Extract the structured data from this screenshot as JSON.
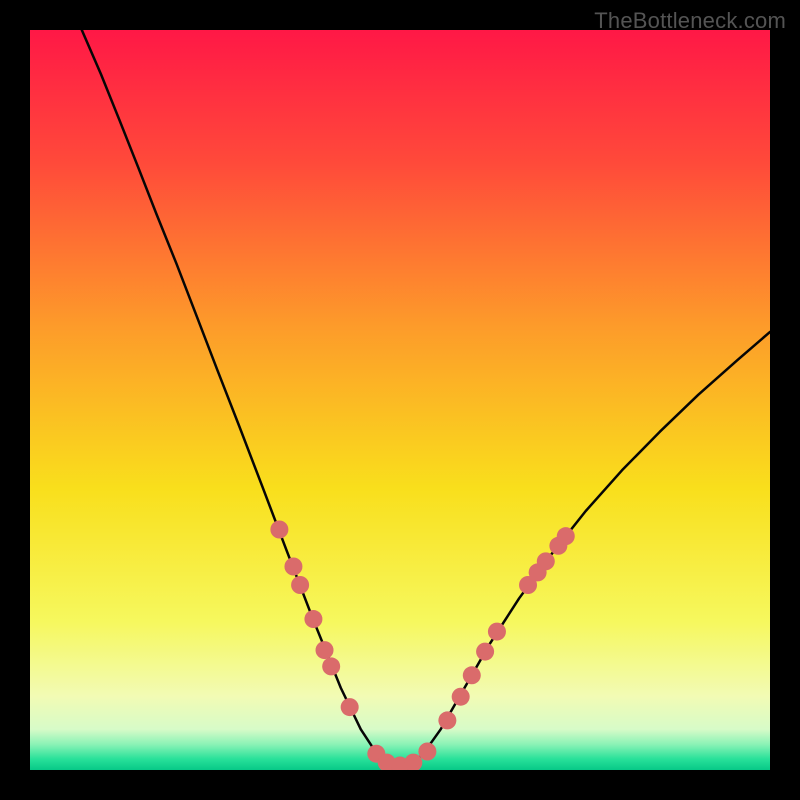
{
  "watermark": "TheBottleneck.com",
  "chart_data": {
    "type": "line",
    "title": "",
    "xlabel": "",
    "ylabel": "",
    "xlim": [
      0,
      1
    ],
    "ylim": [
      0,
      1
    ],
    "background": {
      "type": "vertical_gradient",
      "stops": [
        {
          "pos": 0.0,
          "color": "#ff1846"
        },
        {
          "pos": 0.18,
          "color": "#ff4a3a"
        },
        {
          "pos": 0.4,
          "color": "#fd9b2a"
        },
        {
          "pos": 0.62,
          "color": "#f9df1c"
        },
        {
          "pos": 0.8,
          "color": "#f6f85e"
        },
        {
          "pos": 0.9,
          "color": "#f2fbb4"
        },
        {
          "pos": 0.945,
          "color": "#d7fbc8"
        },
        {
          "pos": 0.965,
          "color": "#8cf3b6"
        },
        {
          "pos": 0.985,
          "color": "#29e19a"
        },
        {
          "pos": 1.0,
          "color": "#07c987"
        }
      ]
    },
    "series": [
      {
        "name": "left_branch",
        "stroke": "#060606",
        "width": 2.5,
        "points": [
          {
            "x": 0.07,
            "y": 1.0
          },
          {
            "x": 0.096,
            "y": 0.94
          },
          {
            "x": 0.121,
            "y": 0.878
          },
          {
            "x": 0.146,
            "y": 0.815
          },
          {
            "x": 0.171,
            "y": 0.751
          },
          {
            "x": 0.198,
            "y": 0.684
          },
          {
            "x": 0.225,
            "y": 0.614
          },
          {
            "x": 0.253,
            "y": 0.541
          },
          {
            "x": 0.283,
            "y": 0.464
          },
          {
            "x": 0.314,
            "y": 0.383
          },
          {
            "x": 0.347,
            "y": 0.296
          },
          {
            "x": 0.382,
            "y": 0.205
          },
          {
            "x": 0.42,
            "y": 0.111
          },
          {
            "x": 0.447,
            "y": 0.055
          },
          {
            "x": 0.47,
            "y": 0.02
          },
          {
            "x": 0.49,
            "y": 0.005
          },
          {
            "x": 0.51,
            "y": 0.005
          }
        ]
      },
      {
        "name": "right_branch",
        "stroke": "#060606",
        "width": 2.5,
        "points": [
          {
            "x": 0.49,
            "y": 0.005
          },
          {
            "x": 0.51,
            "y": 0.005
          },
          {
            "x": 0.53,
            "y": 0.02
          },
          {
            "x": 0.555,
            "y": 0.055
          },
          {
            "x": 0.586,
            "y": 0.109
          },
          {
            "x": 0.621,
            "y": 0.17
          },
          {
            "x": 0.661,
            "y": 0.232
          },
          {
            "x": 0.705,
            "y": 0.292
          },
          {
            "x": 0.751,
            "y": 0.35
          },
          {
            "x": 0.8,
            "y": 0.405
          },
          {
            "x": 0.851,
            "y": 0.457
          },
          {
            "x": 0.903,
            "y": 0.507
          },
          {
            "x": 0.956,
            "y": 0.554
          },
          {
            "x": 1.0,
            "y": 0.592
          }
        ]
      }
    ],
    "markers": {
      "color": "#da6b6b",
      "radius": 9,
      "points": [
        {
          "x": 0.337,
          "y": 0.325
        },
        {
          "x": 0.356,
          "y": 0.275
        },
        {
          "x": 0.365,
          "y": 0.25
        },
        {
          "x": 0.383,
          "y": 0.204
        },
        {
          "x": 0.398,
          "y": 0.162
        },
        {
          "x": 0.407,
          "y": 0.14
        },
        {
          "x": 0.432,
          "y": 0.085
        },
        {
          "x": 0.468,
          "y": 0.022
        },
        {
          "x": 0.482,
          "y": 0.01
        },
        {
          "x": 0.5,
          "y": 0.006
        },
        {
          "x": 0.518,
          "y": 0.01
        },
        {
          "x": 0.537,
          "y": 0.025
        },
        {
          "x": 0.564,
          "y": 0.067
        },
        {
          "x": 0.582,
          "y": 0.099
        },
        {
          "x": 0.597,
          "y": 0.128
        },
        {
          "x": 0.615,
          "y": 0.16
        },
        {
          "x": 0.631,
          "y": 0.187
        },
        {
          "x": 0.673,
          "y": 0.25
        },
        {
          "x": 0.686,
          "y": 0.267
        },
        {
          "x": 0.697,
          "y": 0.282
        },
        {
          "x": 0.714,
          "y": 0.303
        },
        {
          "x": 0.724,
          "y": 0.316
        }
      ]
    }
  }
}
